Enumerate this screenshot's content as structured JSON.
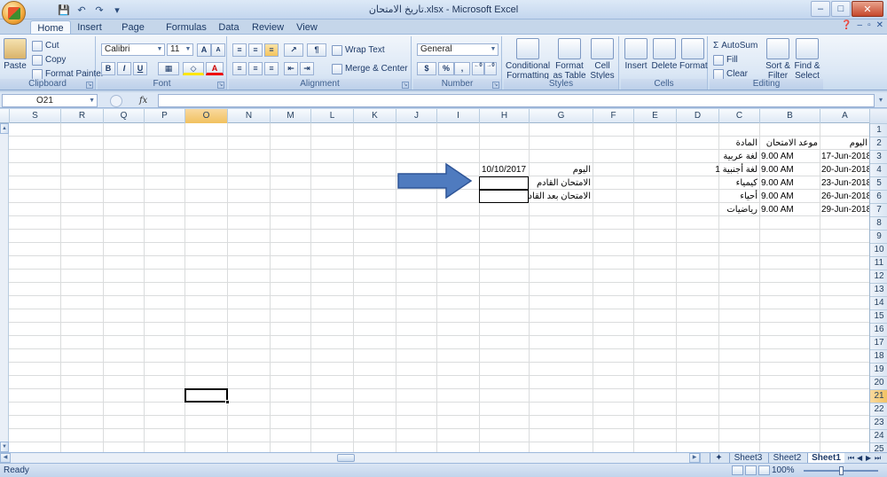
{
  "window": {
    "title": "تاريخ الامتحان.xlsx - Microsoft Excel",
    "minimize": "–",
    "maximize": "□",
    "close": "✕"
  },
  "qat": {
    "save": "💾",
    "undo": "↶",
    "redo": "↷",
    "more": "▾"
  },
  "tabs": [
    "Home",
    "Insert",
    "Page Layout",
    "Formulas",
    "Data",
    "Review",
    "View"
  ],
  "active_tab": "Home",
  "ribbon": {
    "clipboard": {
      "label": "Clipboard",
      "paste": "Paste",
      "cut": "Cut",
      "copy": "Copy",
      "format_painter": "Format Painter"
    },
    "font": {
      "label": "Font",
      "family": "Calibri",
      "size": "11",
      "grow": "A",
      "shrink": "A",
      "bold": "B",
      "italic": "I",
      "underline": "U"
    },
    "alignment": {
      "label": "Alignment",
      "wrap": "Wrap Text",
      "merge": "Merge & Center"
    },
    "number": {
      "label": "Number",
      "format": "General",
      "currency": "$",
      "percent": "%",
      "comma": ",",
      "inc_decimal": ".0\n.00",
      "dec_decimal": ".00\n.0"
    },
    "styles": {
      "label": "Styles",
      "conditional": "Conditional Formatting",
      "as_table": "Format as Table",
      "cell_styles": "Cell Styles"
    },
    "cells": {
      "label": "Cells",
      "insert": "Insert",
      "delete": "Delete",
      "format": "Format"
    },
    "editing": {
      "label": "Editing",
      "autosum": "AutoSum",
      "fill": "Fill",
      "clear": "Clear",
      "sort": "Sort & Filter",
      "find": "Find & Select"
    }
  },
  "formula_bar": {
    "name_box": "O21",
    "fx": "fx",
    "value": ""
  },
  "columns": [
    "S",
    "R",
    "Q",
    "P",
    "O",
    "N",
    "M",
    "L",
    "K",
    "J",
    "I",
    "H",
    "G",
    "F",
    "E",
    "D",
    "C",
    "B",
    "A"
  ],
  "selected_column": "O",
  "rows": [
    "1",
    "2",
    "3",
    "4",
    "5",
    "6",
    "7",
    "8",
    "9",
    "10",
    "11",
    "12",
    "13",
    "14",
    "15",
    "16",
    "17",
    "18",
    "19",
    "20",
    "21",
    "22",
    "23",
    "24",
    "25"
  ],
  "selected_row": "21",
  "sheet": {
    "headers": {
      "day": "اليوم",
      "exam_time": "موعد الامتحان",
      "subject": "المادة"
    },
    "exams": [
      {
        "date": "17-Jun-2018",
        "time": "9.00 AM",
        "subject": "لغة عربية"
      },
      {
        "date": "20-Jun-2018",
        "time": "9.00 AM",
        "subject": "لغة أجنبية 1"
      },
      {
        "date": "23-Jun-2018",
        "time": "9.00 AM",
        "subject": "كيمياء"
      },
      {
        "date": "26-Jun-2018",
        "time": "9.00 AM",
        "subject": "أحياء"
      },
      {
        "date": "29-Jun-2018",
        "time": "9.00 AM",
        "subject": "رياضيات"
      }
    ],
    "today_label": "اليوم",
    "today_value": "10/10/2017",
    "next_exam_label": "الامتحان القادم",
    "after_next_label": "الامتحان بعد القادم"
  },
  "arrow_color": "#4f7bbf",
  "sheet_tabs": [
    "Sheet3",
    "Sheet2",
    "Sheet1"
  ],
  "active_sheet": "Sheet1",
  "status": {
    "text": "Ready",
    "zoom": "100%"
  }
}
